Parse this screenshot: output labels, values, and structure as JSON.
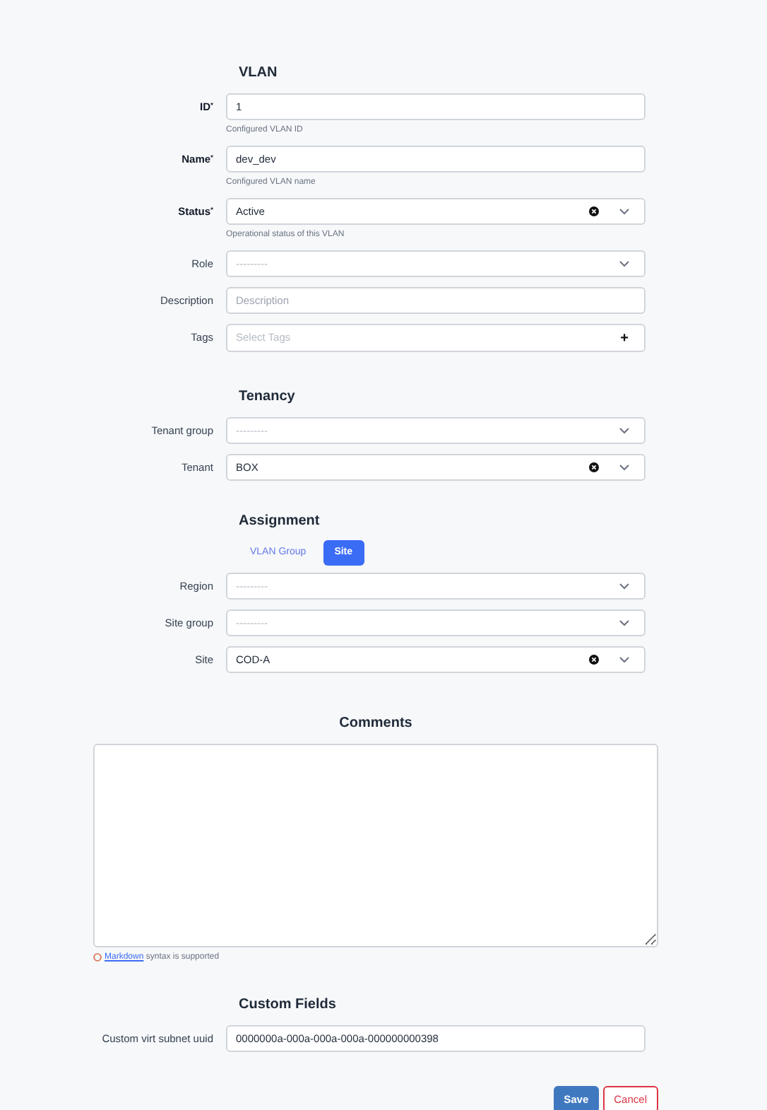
{
  "sections": [
    {
      "title": "VLAN",
      "fields": [
        {
          "kind": "text",
          "label": "ID$^{*}$",
          "required": true,
          "value": "1",
          "help": "Configured VLAN ID"
        },
        {
          "kind": "text",
          "label": "Name$^{*}$",
          "required": true,
          "value": "dev_dev",
          "help": "Configured VLAN name"
        },
        {
          "kind": "select",
          "label": "Status$^{*}$",
          "required": true,
          "value": "Active",
          "help": "Operational status of this VLAN"
        },
        {
          "kind": "select",
          "label": "Role",
          "required": false,
          "placeholder": "---------"
        },
        {
          "kind": "text",
          "label": "Description",
          "required": false,
          "placeholder": "Description"
        },
        {
          "kind": "tags",
          "label": "Tags",
          "required": false,
          "placeholder": "Select Tags",
          "add": "+"
        }
      ]
    },
    {
      "title": "Tenancy",
      "fields": [
        {
          "kind": "select",
          "label": "Tenant group",
          "required": false,
          "placeholder": "---------"
        },
        {
          "kind": "select",
          "label": "Tenant",
          "required": false,
          "value": "BOX"
        }
      ]
    },
    {
      "title": "Assignment",
      "tabs": [
        {
          "label": "VLAN Group",
          "selected": false
        },
        {
          "label": "Site",
          "selected": true
        }
      ],
      "fields": [
        {
          "kind": "select",
          "label": "Region",
          "required": false,
          "placeholder": "---------"
        },
        {
          "kind": "select",
          "label": "Site group",
          "required": false,
          "placeholder": "---------"
        },
        {
          "kind": "select",
          "label": "Site",
          "required": false,
          "value": "COD-A"
        }
      ]
    }
  ],
  "comments": {
    "title": "Comments",
    "note_link": "Markdown",
    "note_text": "syntax is supported"
  },
  "custom_fields": {
    "title": "Custom Fields",
    "fields": [
      {
        "kind": "text",
        "label": "Custom virt subnet uuid",
        "required": false,
        "value": "0000000a-000a-000a-000a-000000000398"
      }
    ]
  },
  "buttons": [
    {
      "kind": "primary",
      "label": "Save"
    },
    {
      "kind": "danger",
      "label": "Cancel"
    }
  ]
}
